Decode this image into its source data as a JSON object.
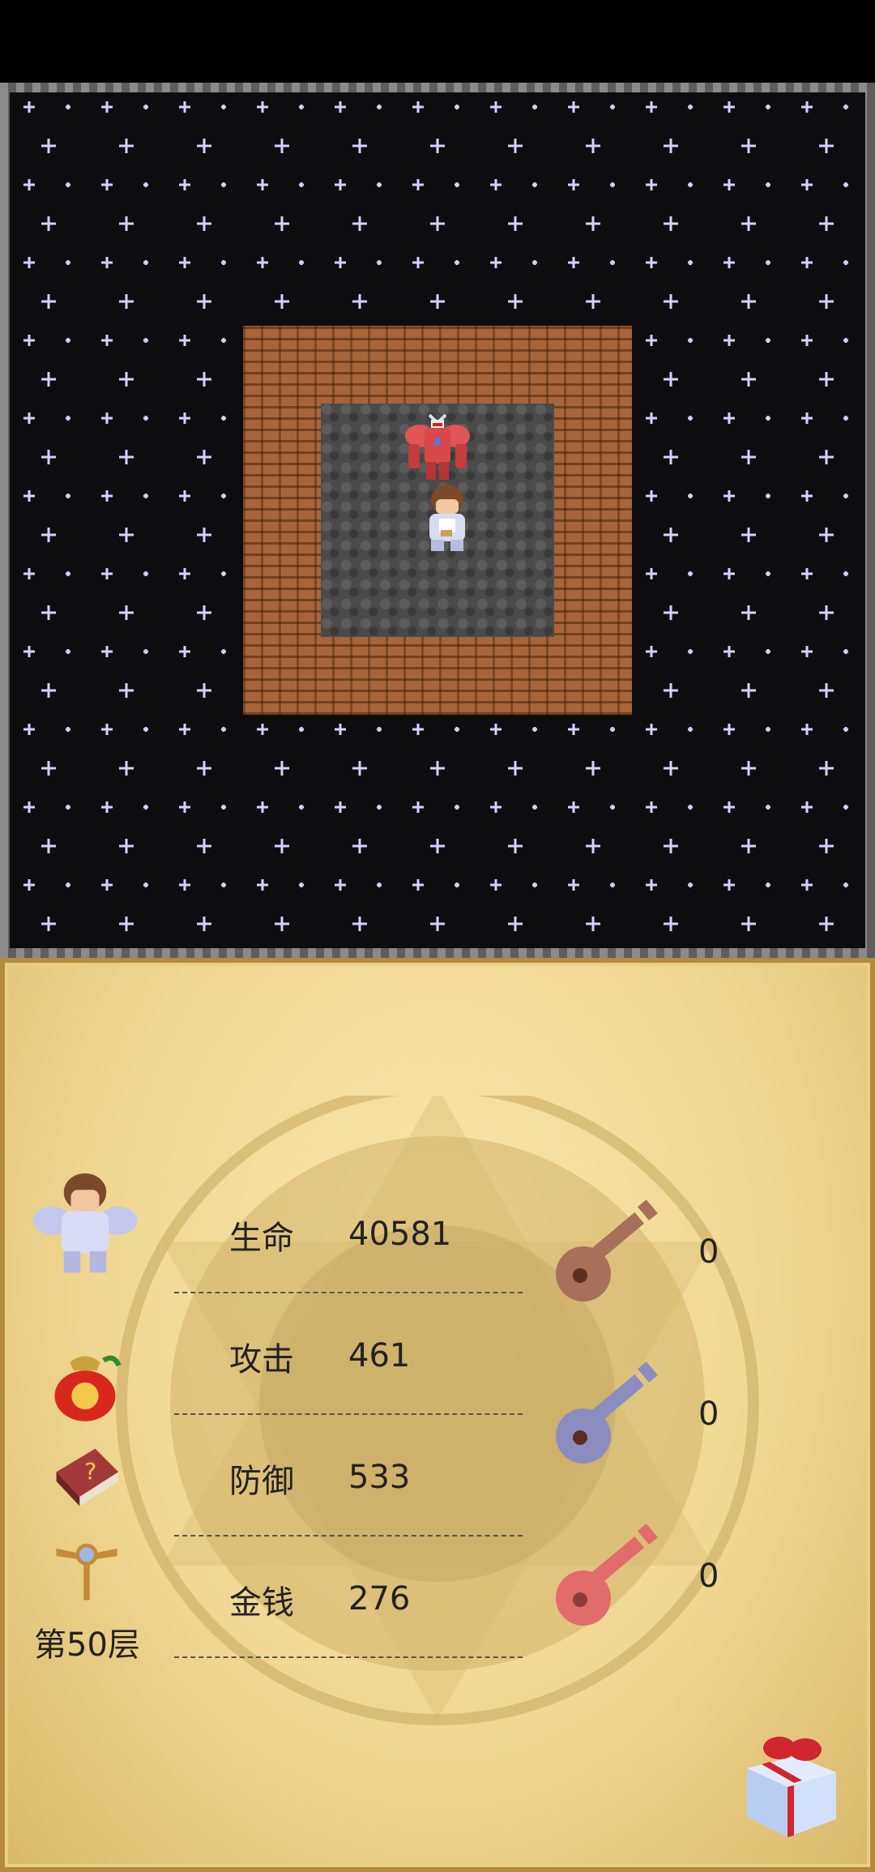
{
  "game": {
    "floor_label": "第50层"
  },
  "stats": [
    {
      "label": "生命",
      "value": "40581"
    },
    {
      "label": "攻击",
      "value": "461"
    },
    {
      "label": "防御",
      "value": "533"
    },
    {
      "label": "金钱",
      "value": "276"
    }
  ],
  "keys": [
    {
      "name": "yellow-key",
      "count": "0",
      "color": "#a8705a"
    },
    {
      "name": "blue-key",
      "count": "0",
      "color": "#8b8cc0"
    },
    {
      "name": "red-key",
      "count": "0",
      "color": "#e26b6b"
    }
  ],
  "colors": {
    "star": "#d8d0ff",
    "wall": "#a8653a",
    "floor": "#4a4a4a",
    "panel": "#f3dc98"
  },
  "icons": [
    "hero-portrait-icon",
    "lucky-bag-icon",
    "monster-manual-icon",
    "floor-fly-icon",
    "gift-box-icon"
  ]
}
